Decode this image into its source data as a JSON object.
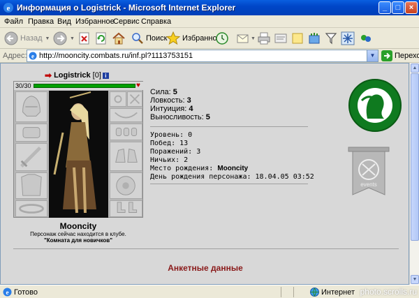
{
  "window": {
    "title": "Информация о Logistrick - Microsoft Internet Explorer",
    "minimize": "_",
    "maximize": "□",
    "close": "×"
  },
  "menu": [
    "Файл",
    "Правка",
    "Вид",
    "Избранное",
    "Сервис",
    "Справка"
  ],
  "toolbar": {
    "back": "Назад",
    "search": "Поиск",
    "favorites": "Избранное"
  },
  "address": {
    "label": "Адрес:",
    "url": "http://mooncity.combats.ru/inf.pl?1113753151",
    "go": "Переход"
  },
  "character": {
    "nick": "Logistrick",
    "level": "[0]",
    "hp": "30/30",
    "hp_fraction": 1.0,
    "city": "Mooncity",
    "location_line": "Персонаж сейчас находится в клубе.",
    "location_room": "\"Комната для новичков\""
  },
  "stats": [
    {
      "label": "Сила:",
      "value": "5"
    },
    {
      "label": "Ловкость:",
      "value": "3"
    },
    {
      "label": "Интуиция:",
      "value": "4"
    },
    {
      "label": "Выносливость:",
      "value": "5"
    }
  ],
  "info": {
    "level": "Уровень: 0",
    "wins": "Побед: 13",
    "losses": "Поражений: 3",
    "draws": "Ничьих: 2",
    "birthplace_label": "Место рождения: ",
    "birthplace": "Mooncity",
    "birthday": "День рождения персонажа: 18.04.05 03:52"
  },
  "section": {
    "anketa": "Анкетные данные"
  },
  "status": {
    "done": "Готово",
    "zone": "Интернет",
    "watermark": "photo.scrolls.ru"
  },
  "colors": {
    "clan_green": "#0f7a1f",
    "hp_green": "#00a000",
    "heading_red": "#8a1a1a"
  }
}
